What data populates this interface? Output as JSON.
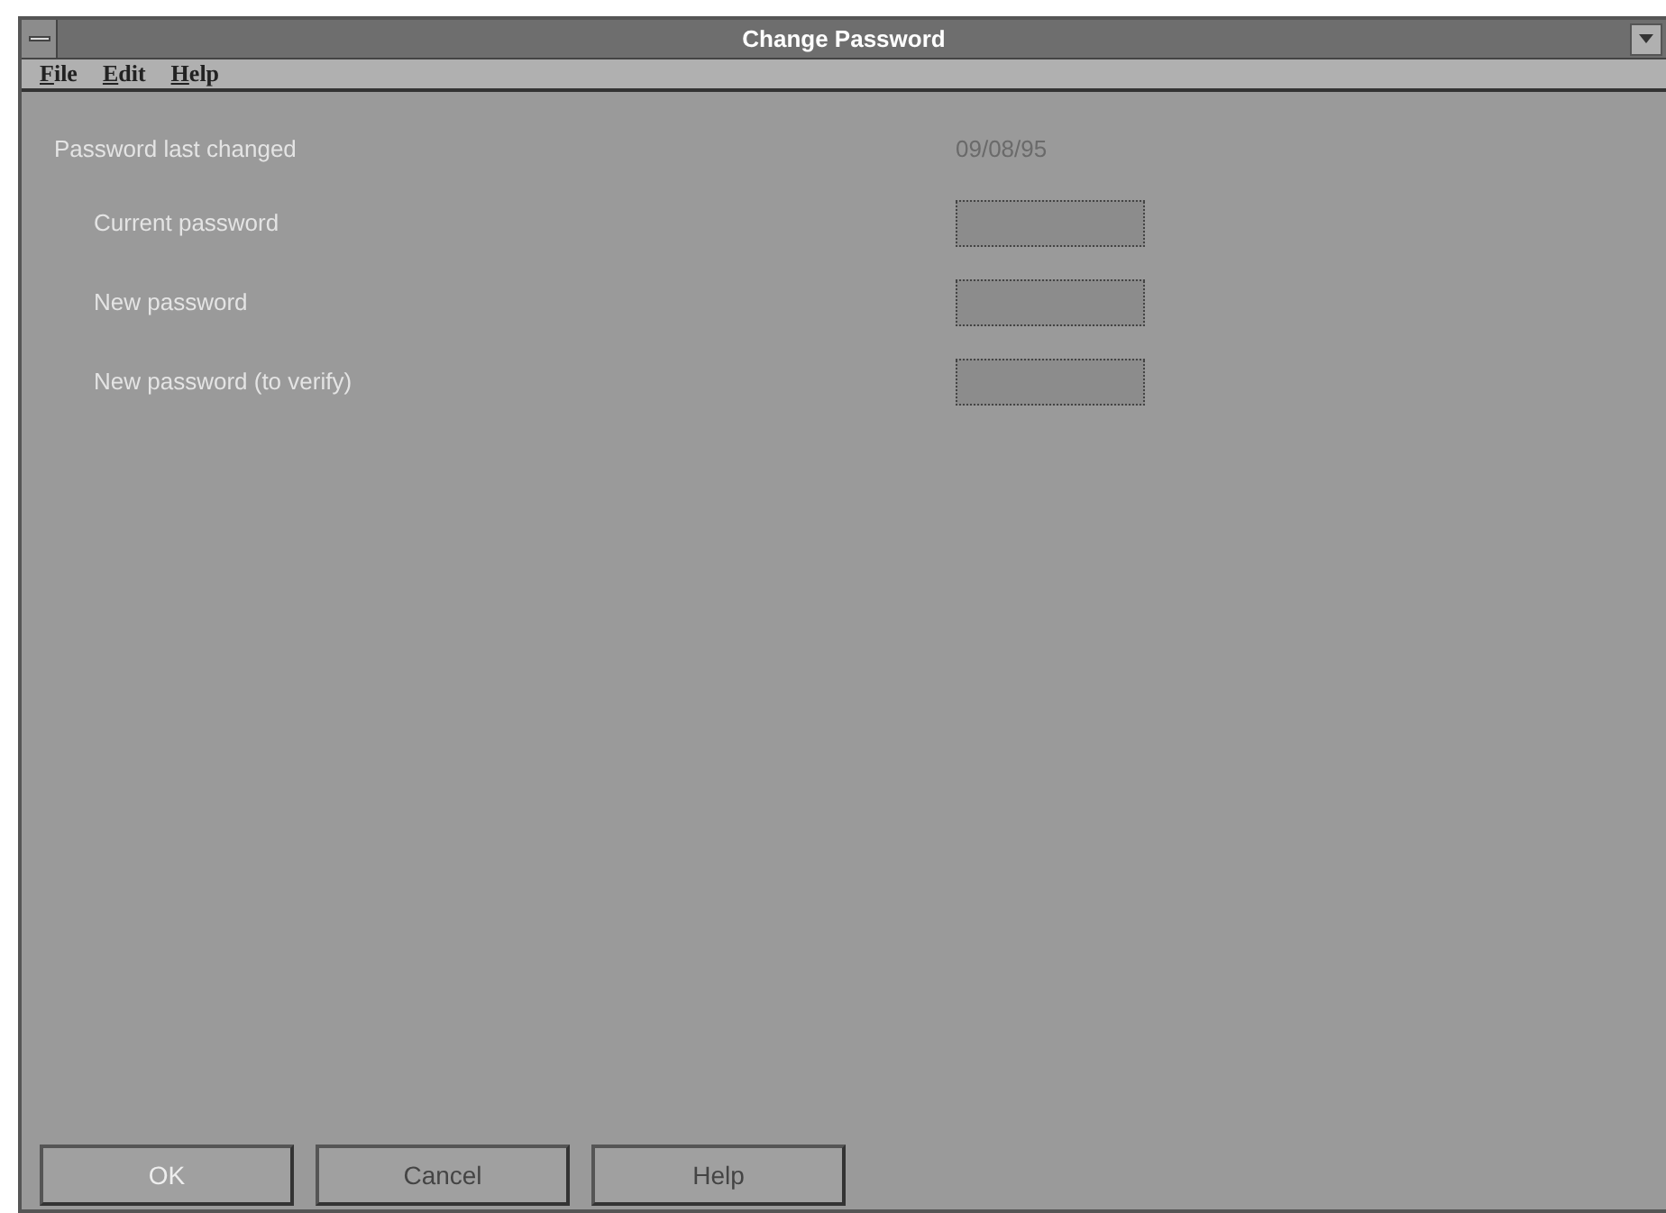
{
  "window": {
    "title": "Change Password"
  },
  "menu": [
    {
      "label": "File"
    },
    {
      "label": "Edit"
    },
    {
      "label": "Help"
    }
  ],
  "last_changed": {
    "label": "Password last changed",
    "value": "09/08/95"
  },
  "fields": [
    {
      "label": "Current password"
    },
    {
      "label": "New password"
    },
    {
      "label": "New password (to verify)"
    }
  ],
  "buttons": [
    {
      "label": "OK",
      "disabled": true
    },
    {
      "label": "Cancel",
      "disabled": false
    },
    {
      "label": "Help",
      "disabled": false
    }
  ]
}
